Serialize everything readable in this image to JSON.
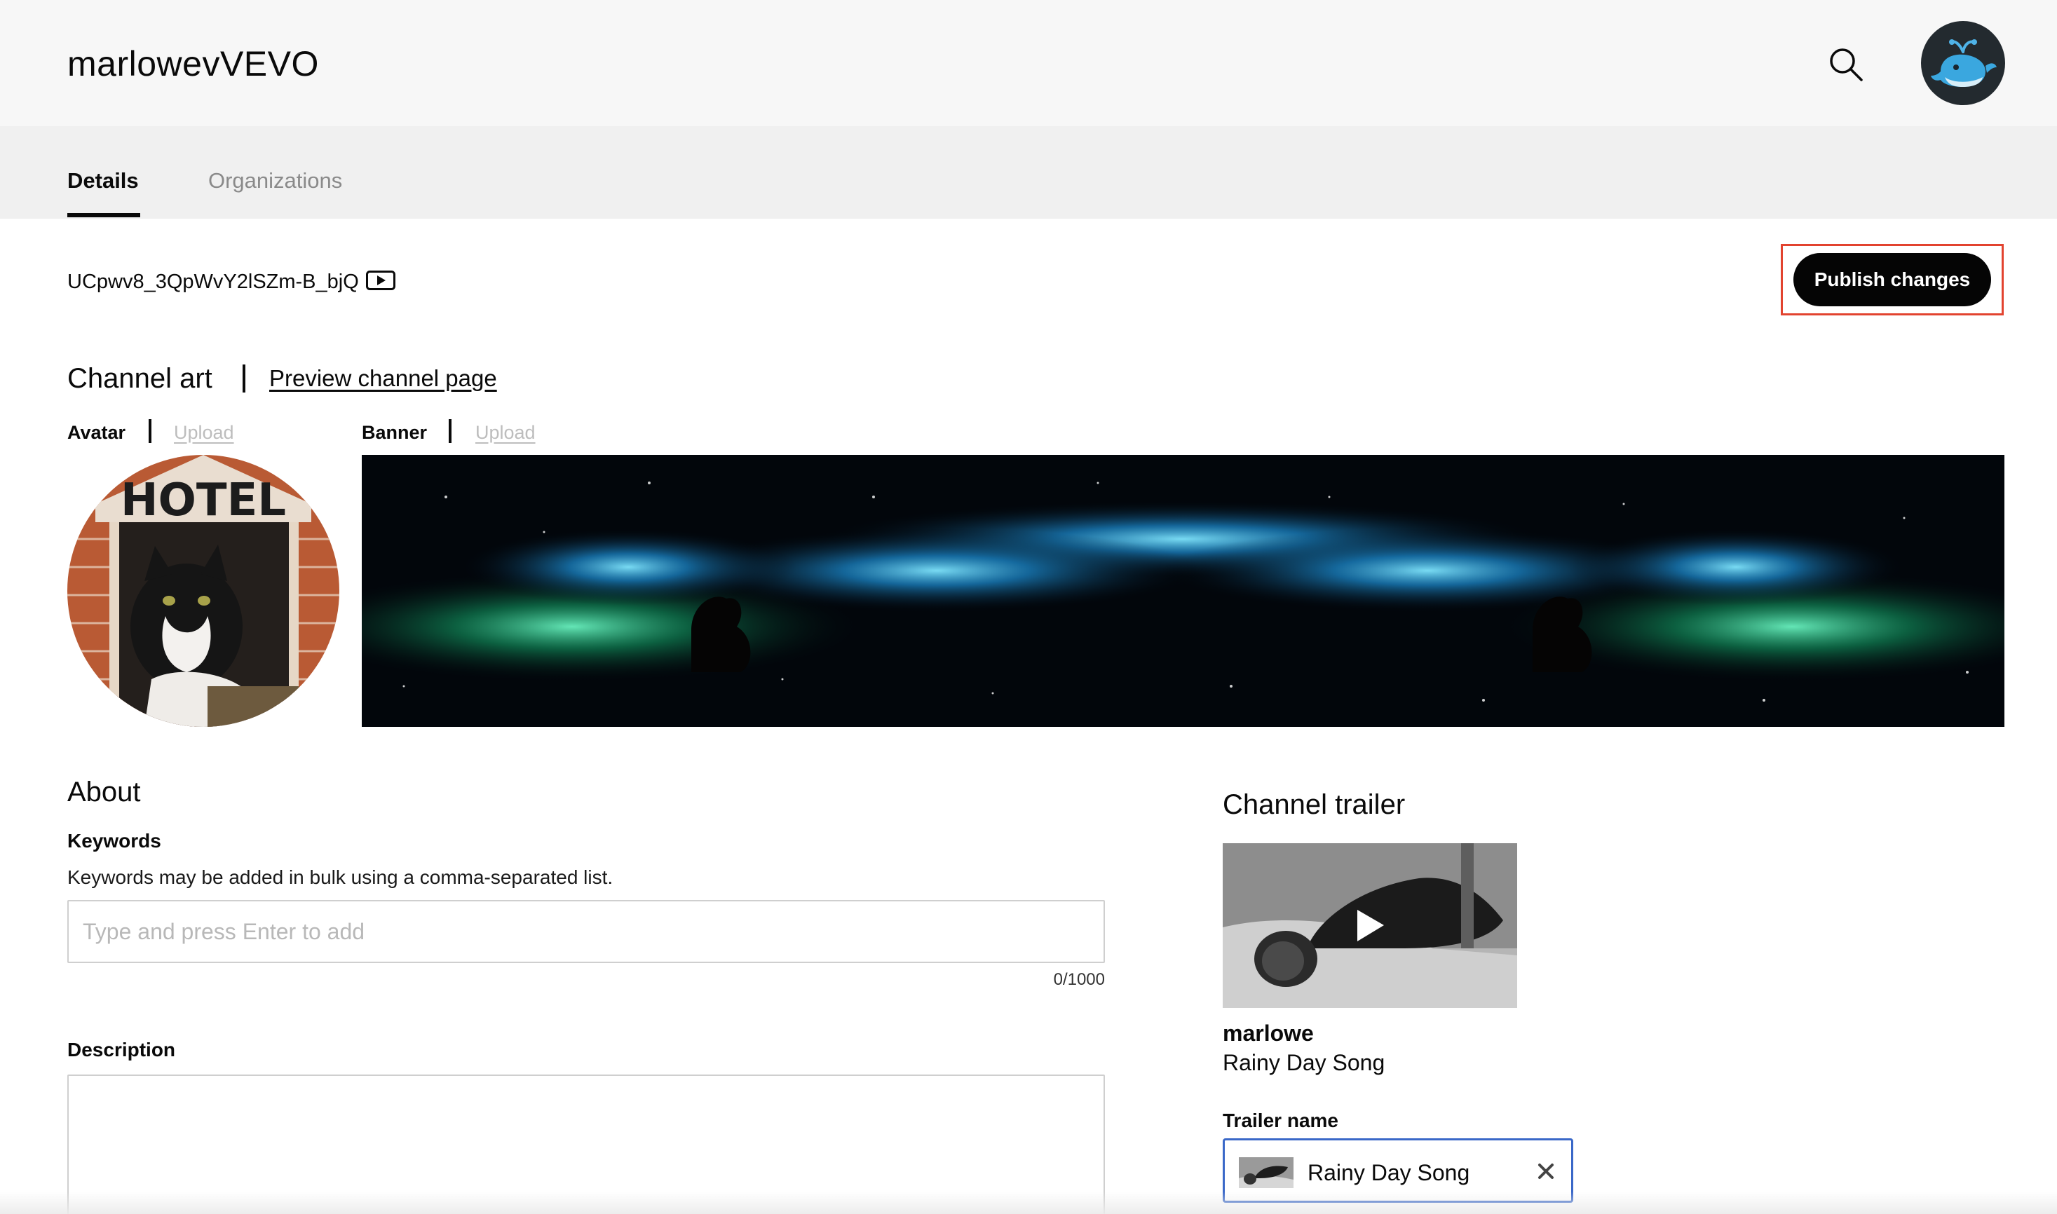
{
  "header": {
    "channel_name": "marlowevVEVO",
    "search_icon": "search-icon",
    "account_icon": "whale-avatar-icon"
  },
  "tabs": [
    {
      "label": "Details",
      "active": true
    },
    {
      "label": "Organizations",
      "active": false
    }
  ],
  "channel": {
    "id": "UCpwv8_3QpWvY2lSZm-B_bjQ",
    "youtube_icon": "youtube-play-icon"
  },
  "toolbar": {
    "publish_label": "Publish changes"
  },
  "channel_art": {
    "title": "Channel art",
    "preview_link": "Preview channel page",
    "avatar_label": "Avatar",
    "avatar_upload": "Upload",
    "banner_label": "Banner",
    "banner_upload": "Upload"
  },
  "about": {
    "title": "About",
    "keywords_label": "Keywords",
    "keywords_helper": "Keywords may be added in bulk using a comma-separated list.",
    "keywords_placeholder": "Type and press Enter to add",
    "keywords_value": "",
    "keywords_counter": "0/1000",
    "description_label": "Description",
    "description_value": ""
  },
  "trailer": {
    "title": "Channel trailer",
    "artist": "marlowe",
    "song": "Rainy Day Song",
    "name_label": "Trailer name",
    "selected_value": "Rainy Day Song",
    "play_icon": "play-icon",
    "clear_icon": "close-icon"
  },
  "colors": {
    "header_bg": "#f7f7f7",
    "tabbar_bg": "#f0f0f0",
    "publish_bg": "#050505",
    "highlight_border": "#e2432f",
    "select_border": "#3a68c8",
    "upload_link": "#bdbdbd"
  }
}
